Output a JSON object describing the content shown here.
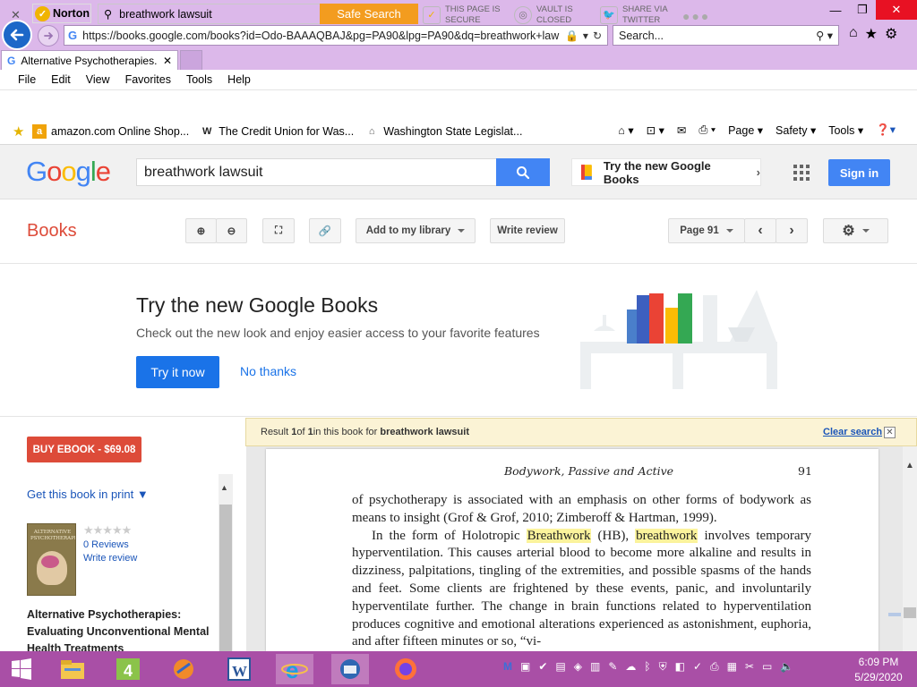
{
  "browser": {
    "url": "https://books.google.com/books?id=Odo-BAAAQBAJ&pg=PA90&lpg=PA90&dq=breathwork+law",
    "search_placeholder": "Search...",
    "tab_title": "Alternative Psychotherapies...",
    "menu": [
      "File",
      "Edit",
      "View",
      "Favorites",
      "Tools",
      "Help"
    ],
    "norton": {
      "brand": "Norton",
      "search_value": "breathwork lawsuit",
      "safe_search": "Safe Search",
      "page_secure": [
        "THIS PAGE IS",
        "SECURE"
      ],
      "vault": [
        "VAULT IS",
        "CLOSED"
      ],
      "share": [
        "SHARE VIA",
        "TWITTER"
      ]
    },
    "favorites": [
      {
        "label": "amazon.com Online Shop...",
        "icon": "a"
      },
      {
        "label": "The Credit Union for Was...",
        "icon": "W"
      },
      {
        "label": "Washington State Legislat...",
        "icon": "⌂"
      }
    ],
    "commands": {
      "page": "Page",
      "safety": "Safety",
      "tools": "Tools"
    }
  },
  "google": {
    "search_value": "breathwork lawsuit",
    "try_new": "Try the new Google Books",
    "sign_in": "Sign in"
  },
  "books": {
    "title": "Books",
    "add_library": "Add to my library",
    "write_review": "Write review",
    "page_label": "Page 91"
  },
  "promo": {
    "title": "Try the new Google Books",
    "subtitle": "Check out the new look and enjoy easier access to your favorite features",
    "try_it_now": "Try it now",
    "no_thanks": "No thanks"
  },
  "sidebar": {
    "buy_ebook": "BUY EBOOK - $69.08",
    "get_book": "Get this book in print ▼",
    "stars": "★★★★★",
    "reviews": "0 Reviews",
    "write_review": "Write review",
    "cover_text": "ALTERNATIVE PSYCHOTHERAPIES",
    "book_title": "Alternative Psychotherapies: Evaluating Unconventional Mental Health Treatments"
  },
  "result": {
    "prefix": "Result ",
    "num": "1",
    "of": " of ",
    "total": "1",
    "middle": " in this book for ",
    "query": "breathwork lawsuit",
    "clear": "Clear search"
  },
  "page": {
    "header": "Bodywork, Passive and Active",
    "number": "91",
    "p1": "of psychotherapy is associated with an emphasis on other forms of bodywork as means to insight (Grof & Grof, 2010; Zimberoff & Hartman, 1999).",
    "p2_a": "In the form of Holotropic ",
    "p2_hl1": "Breathwork",
    "p2_b": " (HB), ",
    "p2_hl2": "breathwork",
    "p2_c": " involves temporary hyperventilation. This causes arterial blood to become more alkaline and results in dizziness, palpitations, tingling of the extremities, and possible spasms of the hands and feet. Some clients are frightened by these events, panic, and involuntarily hyperventilate further. The change in brain functions related to hyperventilation produces cognitive and emotional alterations experienced as astonishment, euphoria, and after fifteen minutes or so, “vi-"
  },
  "taskbar": {
    "time": "6:09 PM",
    "date": "5/29/2020"
  },
  "colors": {
    "ie_chrome": "#dcb8ea",
    "google_blue": "#4285f4",
    "books_red": "#dd4b39",
    "taskbar": "#a94fa6",
    "highlight": "#fbf39c"
  }
}
